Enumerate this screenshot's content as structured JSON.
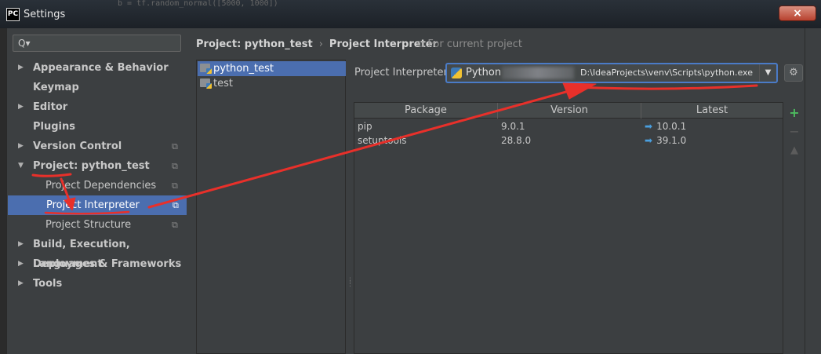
{
  "window": {
    "app_icon": "PC",
    "title": "Settings",
    "background_code": "b = tf.random_normal([5000, 1000])",
    "close_icon": "×"
  },
  "sidebar": {
    "search_icon": "Q▾",
    "items": [
      {
        "label": "Appearance & Behavior",
        "arrow": "▶",
        "level": 0
      },
      {
        "label": "Keymap",
        "arrow": "",
        "level": 0
      },
      {
        "label": "Editor",
        "arrow": "▶",
        "level": 0
      },
      {
        "label": "Plugins",
        "arrow": "",
        "level": 0
      },
      {
        "label": "Version Control",
        "arrow": "▶",
        "level": 0,
        "copy": true
      },
      {
        "label": "Project: python_test",
        "arrow": "▼",
        "level": 0,
        "copy": true
      },
      {
        "label": "Project Dependencies",
        "level": 1,
        "copy": true
      },
      {
        "label": "Project Interpreter",
        "level": 1,
        "copy": true,
        "selected": true
      },
      {
        "label": "Project Structure",
        "level": 1,
        "copy": true
      },
      {
        "label": "Build, Execution, Deployment",
        "arrow": "▶",
        "level": 0
      },
      {
        "label": "Languages & Frameworks",
        "arrow": "▶",
        "level": 0
      },
      {
        "label": "Tools",
        "arrow": "▶",
        "level": 0
      }
    ],
    "copy_icon": "⧉"
  },
  "header": {
    "crumb_1": "Project: python_test",
    "separator": "›",
    "crumb_2": "Project Interpreter",
    "for_current": "⧉ For current project"
  },
  "project_tree": {
    "items": [
      {
        "label": "python_test",
        "selected": true
      },
      {
        "label": "test",
        "selected": false
      }
    ]
  },
  "interpreter": {
    "label": "Project Interpreter:",
    "name": "Python",
    "path": "D:\\IdeaProjects\\venv\\Scripts\\python.exe",
    "dropdown_icon": "▼",
    "settings_icon": "⚙"
  },
  "packages": {
    "columns": [
      "Package",
      "Version",
      "Latest"
    ],
    "rows": [
      {
        "package": "pip",
        "version": "9.0.1",
        "latest": "10.0.1"
      },
      {
        "package": "setuptools",
        "version": "28.8.0",
        "latest": "39.1.0"
      }
    ],
    "upgrade_arrow": "➡"
  },
  "tools": {
    "add": "+",
    "remove": "−",
    "upgrade": "▲"
  },
  "colors": {
    "selection": "#4b6eaf",
    "annotation": "#e8302a",
    "add": "#4dbb5f",
    "upgrade_arrow": "#4a9fdf"
  }
}
